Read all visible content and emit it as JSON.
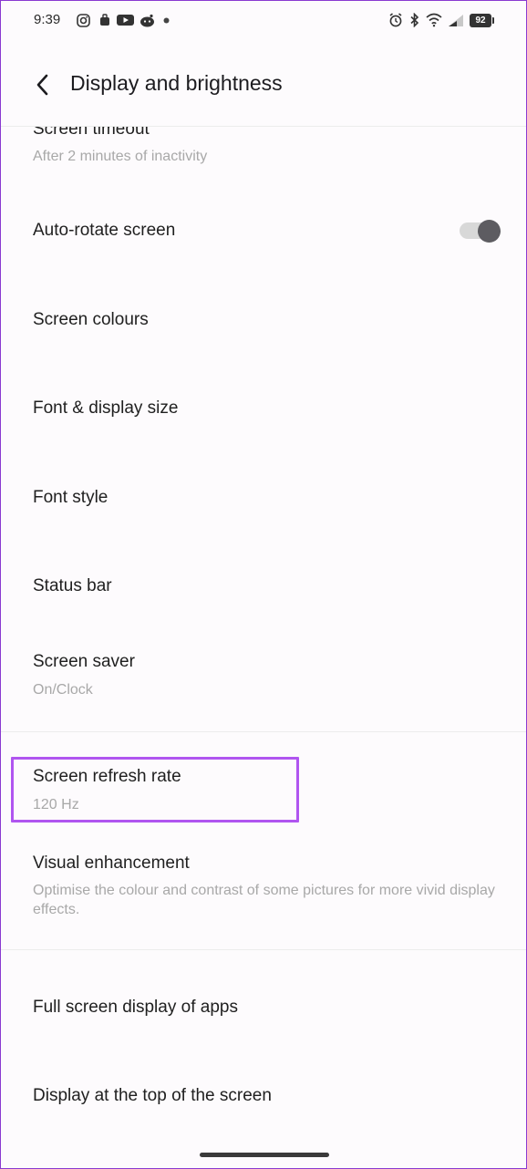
{
  "status_bar": {
    "time": "9:39",
    "battery": "92"
  },
  "header": {
    "title": "Display and brightness"
  },
  "settings": [
    {
      "title": "Screen timeout",
      "subtitle": "After 2 minutes of inactivity"
    },
    {
      "title": "Auto-rotate screen",
      "toggle_on": true
    },
    {
      "title": "Screen colours"
    },
    {
      "title": "Font & display size"
    },
    {
      "title": "Font style"
    },
    {
      "title": "Status bar"
    },
    {
      "title": "Screen saver",
      "subtitle": "On/Clock"
    },
    {
      "title": "Screen refresh rate",
      "subtitle": "120 Hz"
    },
    {
      "title": "Visual enhancement",
      "subtitle": "Optimise the colour and contrast of some pictures for more vivid display effects."
    },
    {
      "title": "Full screen display of apps"
    },
    {
      "title": "Display at the top of the screen"
    }
  ],
  "colors": {
    "highlight": "#b055f0",
    "toggle_knob": "#5d5c61",
    "subtitle_text": "#a8a8a8"
  }
}
